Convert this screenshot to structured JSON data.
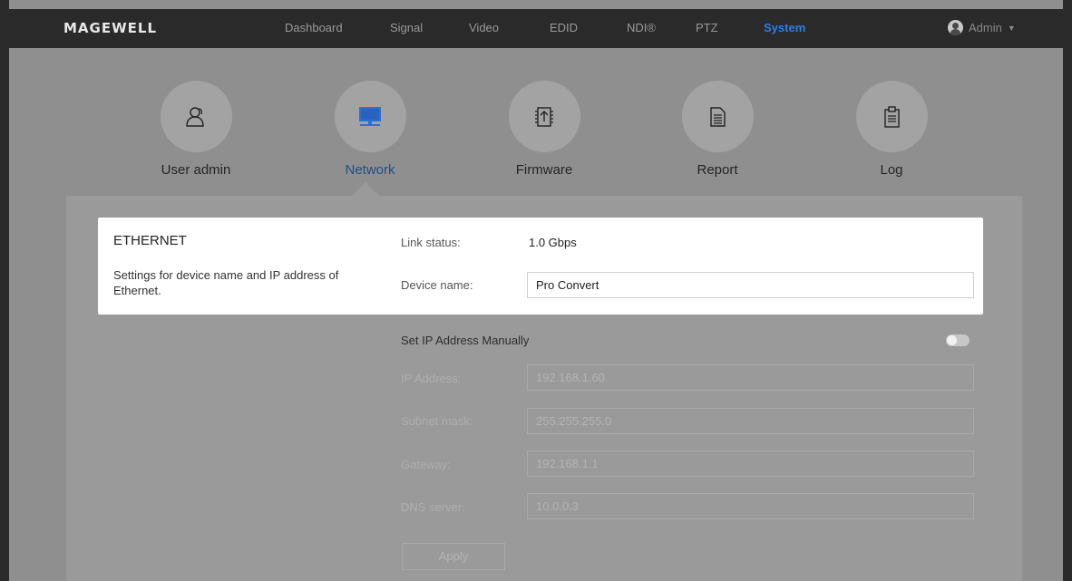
{
  "brand": {
    "logo_text": "MAGEWELL"
  },
  "nav": {
    "items": [
      {
        "label": "Dashboard",
        "active": false
      },
      {
        "label": "Signal",
        "active": false
      },
      {
        "label": "Video",
        "active": false
      },
      {
        "label": "EDID",
        "active": false
      },
      {
        "label": "NDI®",
        "active": false
      },
      {
        "label": "PTZ",
        "active": false
      },
      {
        "label": "System",
        "active": true
      }
    ],
    "user": "Admin"
  },
  "categories": [
    {
      "label": "User admin",
      "icon": "user-group-icon",
      "active": false
    },
    {
      "label": "Network",
      "icon": "monitor-network-icon",
      "active": true
    },
    {
      "label": "Firmware",
      "icon": "firmware-upload-icon",
      "active": false
    },
    {
      "label": "Report",
      "icon": "report-document-icon",
      "active": false
    },
    {
      "label": "Log",
      "icon": "clipboard-log-icon",
      "active": false
    }
  ],
  "ethernet": {
    "title": "ETHERNET",
    "description": "Settings for device name and IP address of Ethernet.",
    "link_status_label": "Link status:",
    "link_status_value": "1.0 Gbps",
    "device_name_label": "Device name:",
    "device_name_value": "Pro Convert"
  },
  "ip_settings": {
    "manual_label": "Set IP Address Manually",
    "manual_enabled": false,
    "fields": [
      {
        "label": "IP Address:",
        "value": "192.168.1.60"
      },
      {
        "label": "Subnet mask:",
        "value": "255.255.255.0"
      },
      {
        "label": "Gateway:",
        "value": "192.168.1.1"
      },
      {
        "label": "DNS server:",
        "value": "10.0.0.3"
      }
    ],
    "apply_label": "Apply"
  },
  "colors": {
    "accent": "#2f7fe0",
    "navbar_bg": "#2a2a2a",
    "overlay_bg": "#8f8f8f",
    "card_bg": "#ffffff"
  }
}
